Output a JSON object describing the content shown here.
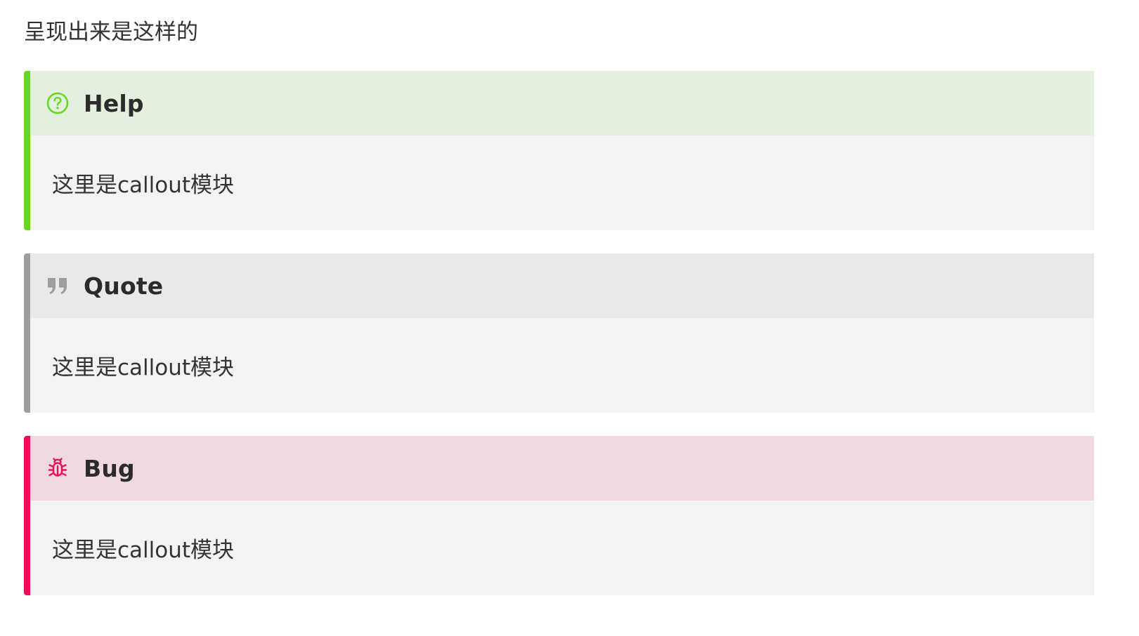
{
  "intro_text": "呈现出来是这样的",
  "callouts": [
    {
      "type": "help",
      "title": "Help",
      "icon": "help-circle-icon",
      "accent_color": "#67d81e",
      "body": "这里是callout模块"
    },
    {
      "type": "quote",
      "title": "Quote",
      "icon": "quote-icon",
      "accent_color": "#9e9e9e",
      "body": "这里是callout模块"
    },
    {
      "type": "bug",
      "title": "Bug",
      "icon": "bug-icon",
      "accent_color": "#eb0f55",
      "body": "这里是callout模块"
    }
  ]
}
